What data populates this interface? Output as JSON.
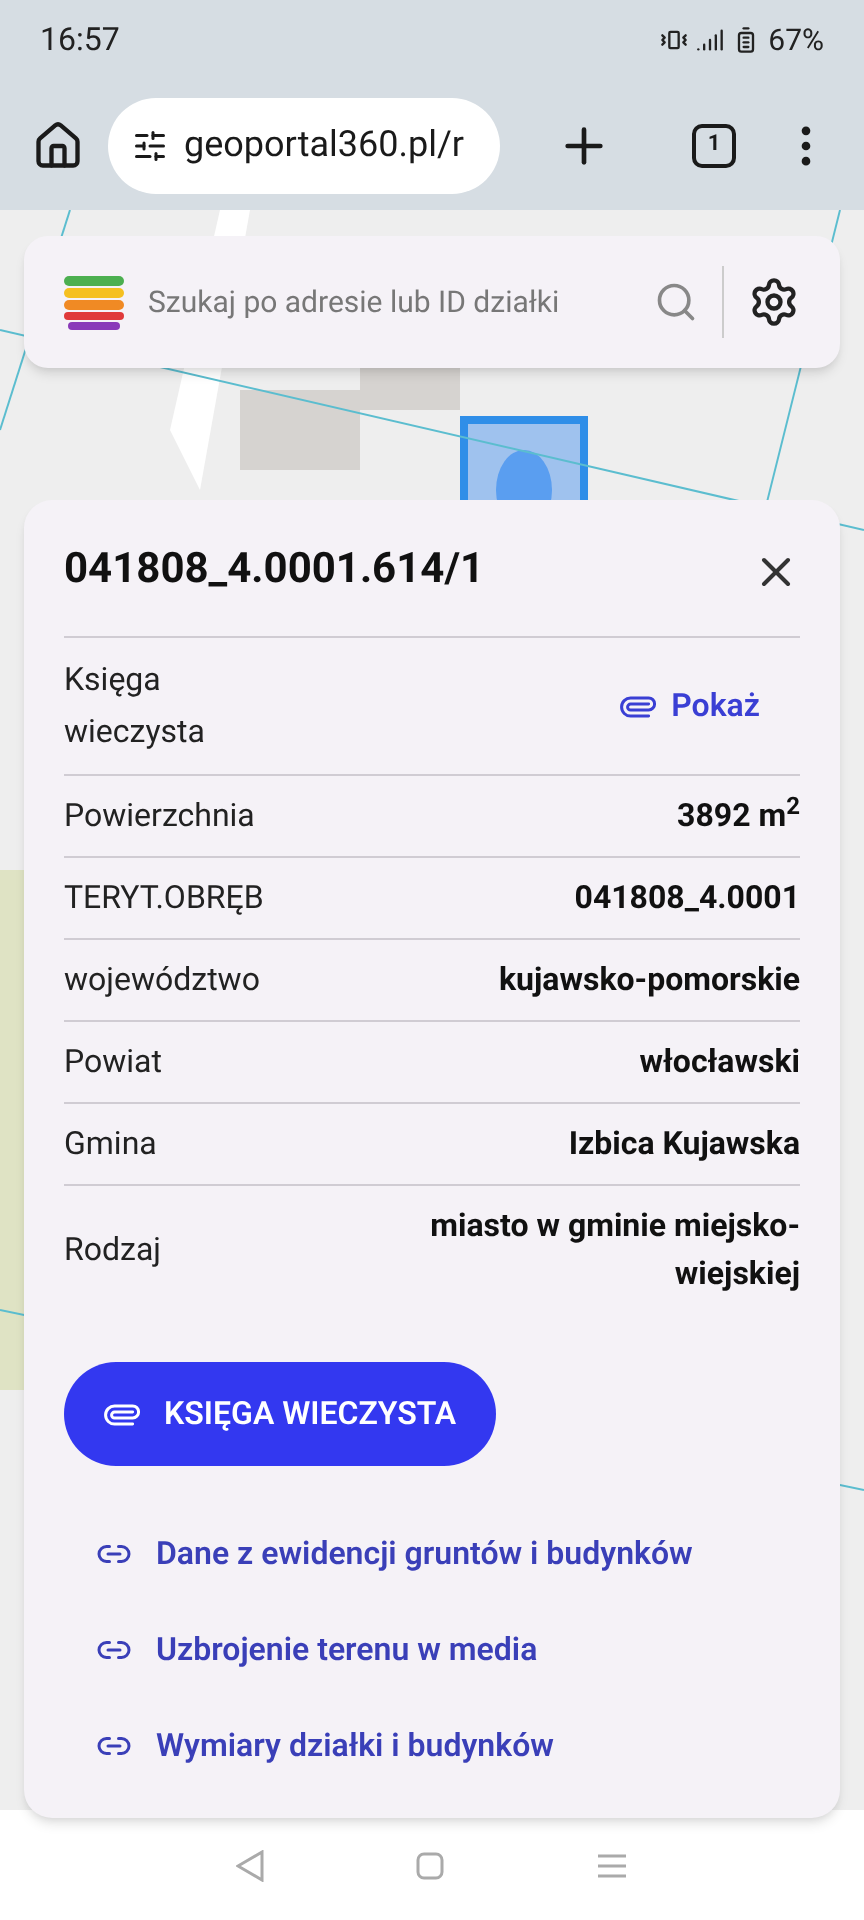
{
  "status_bar": {
    "time": "16:57",
    "battery": "67%"
  },
  "browser": {
    "url": "geoportal360.pl/r",
    "tab_count": "1"
  },
  "search": {
    "placeholder": "Szukaj po adresie lub ID działki"
  },
  "parcel": {
    "title": "041808_4.0001.614/1",
    "rows": [
      {
        "kind": "link",
        "label": "Księga wieczysta",
        "value": "Pokaż"
      },
      {
        "kind": "text",
        "label": "Powierzchnia",
        "value": "3892 m$^{2}$"
      },
      {
        "kind": "text",
        "label": "TERYT.OBRĘB",
        "value": "041808_4.0001"
      },
      {
        "kind": "text",
        "label": "województwo",
        "value": "kujawsko-pomorskie"
      },
      {
        "kind": "text",
        "label": "Powiat",
        "value": "włocławski"
      },
      {
        "kind": "text",
        "label": "Gmina",
        "value": "Izbica Kujawska"
      },
      {
        "kind": "text",
        "label": "Rodzaj",
        "value": "miasto w gminie miejsko-wiejskiej"
      }
    ],
    "primary_button": "KSIĘGA WIECZYSTA",
    "links": [
      "Dane z ewidencji gruntów i budynków",
      "Uzbrojenie terenu w media",
      "Wymiary działki i budynków"
    ]
  }
}
